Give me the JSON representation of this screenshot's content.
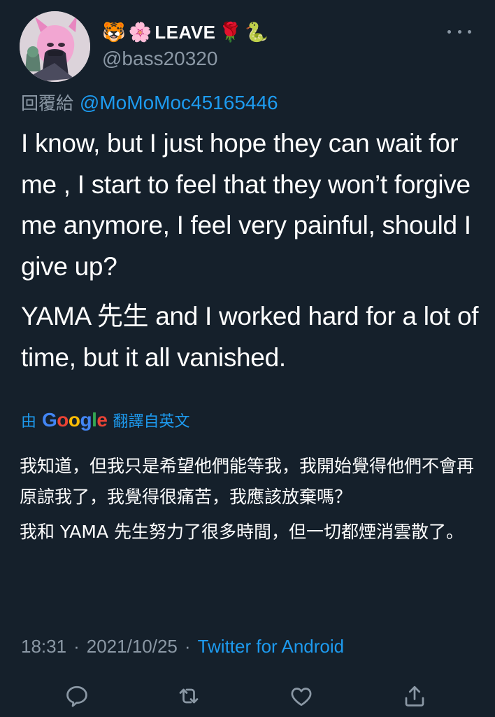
{
  "user": {
    "emojis_before": [
      "🐯",
      "🌸"
    ],
    "display_name": "LEAVE",
    "emojis_after": [
      "🌹",
      "🐍"
    ],
    "handle": "@bass20320"
  },
  "reply": {
    "prefix": "回覆給",
    "mention": "@MoMoMoc45165446"
  },
  "tweet": {
    "paragraphs": [
      "I know, but I just hope they can wait for me , I start to feel that they won’t forgive me anymore, I feel very painful, should I give up?",
      "YAMA 先生 and I worked hard for a lot of time, but it all vanished."
    ]
  },
  "translation": {
    "by_label": "由",
    "provider": "Google",
    "from_label": "翻譯自英文",
    "paragraphs": [
      "我知道，但我只是希望他們能等我，我開始覺得他們不會再原諒我了，我覺得很痛苦，我應該放棄嗎？",
      "我和 YAMA 先生努力了很多時間，但一切都煙消雲散了。"
    ]
  },
  "meta": {
    "time": "18:31",
    "sep1": "·",
    "date": "2021/10/25",
    "sep2": "·",
    "source": "Twitter for Android"
  },
  "icons": {
    "more": "more-options-icon",
    "reply": "reply-icon",
    "retweet": "retweet-icon",
    "like": "like-icon",
    "share": "share-icon"
  },
  "colors": {
    "background": "#15202b",
    "text": "#ffffff",
    "secondary": "#8b98a5",
    "accent": "#1d9bf0"
  }
}
